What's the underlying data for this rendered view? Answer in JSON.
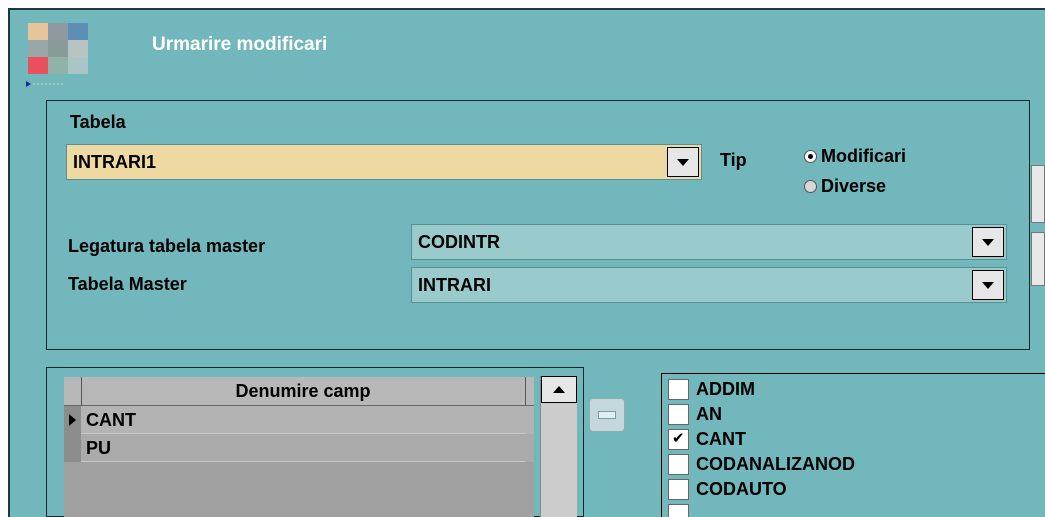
{
  "window": {
    "title": "Urmarire modificari",
    "logo_colors": [
      "#e7c59a",
      "#8e9aa0",
      "#5b8fb5",
      "#9aa7a8",
      "#8a9a98",
      "#b6c5c2",
      "#e8515b",
      "#8fb3a8",
      "#a9c6c4"
    ],
    "bg_color": "#72b7bb"
  },
  "tabela": {
    "label": "Tabela",
    "value": "INTRARI1"
  },
  "tip": {
    "label": "Tip",
    "options": [
      {
        "label": "Modificari",
        "selected": true
      },
      {
        "label": "Diverse",
        "selected": false
      }
    ]
  },
  "master_link": {
    "label": "Legatura tabela master",
    "value": "CODINTR"
  },
  "master_table": {
    "label": "Tabela Master",
    "value": "INTRARI"
  },
  "fields_grid": {
    "column_header": "Denumire camp",
    "rows": [
      {
        "value": "CANT",
        "current": true
      },
      {
        "value": "PU",
        "current": false
      }
    ]
  },
  "checklist": {
    "items": [
      {
        "label": "ADDIM",
        "checked": false
      },
      {
        "label": "AN",
        "checked": false
      },
      {
        "label": "CANT",
        "checked": true
      },
      {
        "label": "CODANALIZANOD",
        "checked": false
      },
      {
        "label": "CODAUTO",
        "checked": false
      }
    ]
  }
}
